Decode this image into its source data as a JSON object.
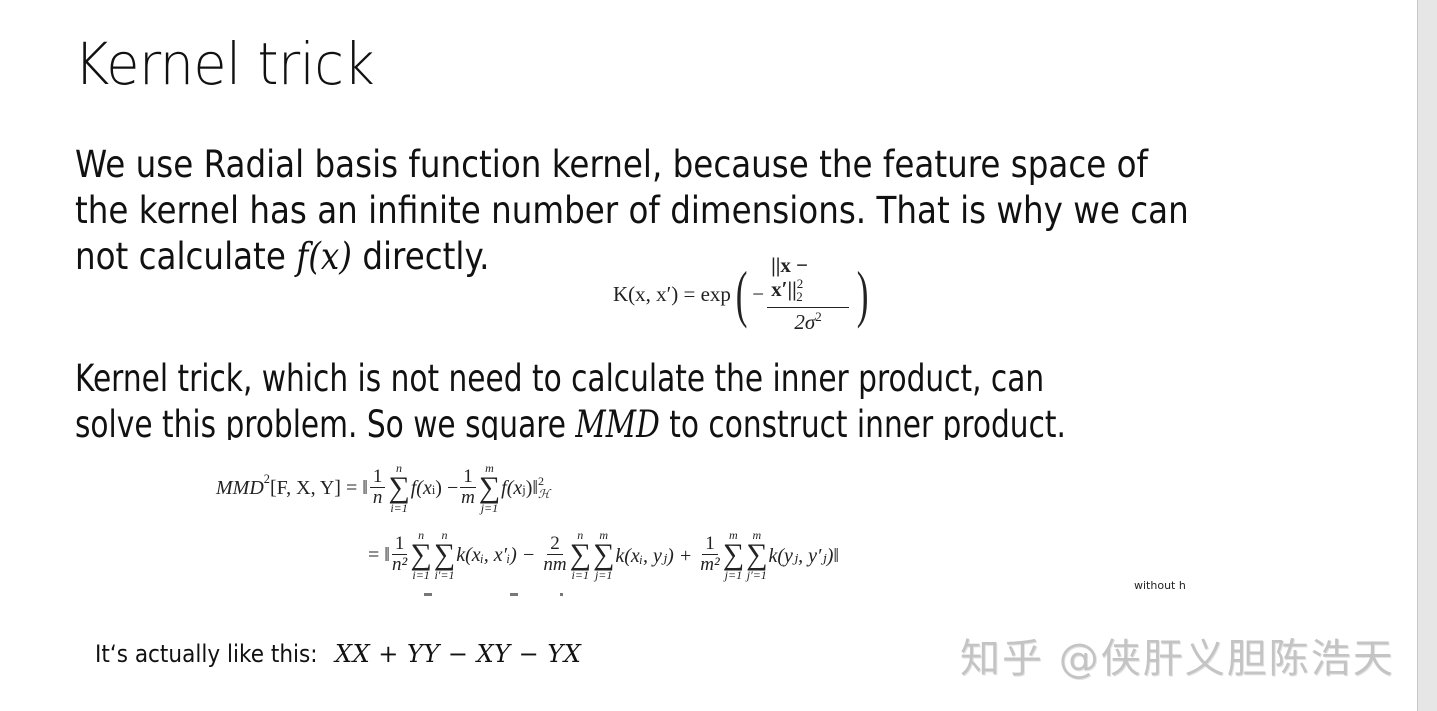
{
  "slide": {
    "title": "Kernel trick",
    "paragraph1": {
      "text_before": "We use Radial basis function kernel, because the feature space of the kernel has an infinite number of dimensions. That is why we can not calculate ",
      "line1": "We use Radial basis function kernel, because the feature space of",
      "line2": "the kernel has an infinite number of dimensions. That is why we can",
      "line3_before": "not calculate ",
      "math": "f(x)",
      "line3_after": " directly."
    },
    "rbf_formula": {
      "lhs": "K(x, x′) = exp",
      "numerator": "||x − x′||",
      "numerator_sup": "2",
      "numerator_sub": "2",
      "denominator": "2σ",
      "denominator_sup": "2",
      "sign": "−"
    },
    "paragraph2": {
      "line1": "Kernel trick, which is not need to calculate the inner product, can",
      "line2_before": "solve this problem. So we square ",
      "math": "MMD",
      "line2_after": " to construct inner product."
    },
    "mmd_formula": {
      "line1": {
        "lhs": "MMD",
        "lhs_sup": "2",
        "args": "[F, X, Y] = ‖",
        "frac1_num": "1",
        "frac1_den": "n",
        "sum1_top": "n",
        "sum1_bot": "i=1",
        "term1": "f(x",
        "term1_sub": "i",
        "minus": ") −",
        "frac2_num": "1",
        "frac2_den": "m",
        "sum2_top": "m",
        "sum2_bot": "j=1",
        "term2": "f(x",
        "term2_sub": "j",
        "end": ")‖",
        "end_sup": "2",
        "end_sub": "ℋ"
      },
      "line2": {
        "eq": "= ‖",
        "frac1_num": "1",
        "frac1_den": "n²",
        "sumA_top": "n",
        "sumA_bot": "i=1",
        "sumB_top": "n",
        "sumB_bot": "i′=1",
        "termA": "k(xᵢ, x′ᵢ) −",
        "frac2_num": "2",
        "frac2_den": "nm",
        "sumC_top": "n",
        "sumC_bot": "i=1",
        "sumD_top": "m",
        "sumD_bot": "j=1",
        "termB": "k(xᵢ, yⱼ) +",
        "frac3_num": "1",
        "frac3_den": "m²",
        "sumE_top": "m",
        "sumE_bot": "j=1",
        "sumF_top": "m",
        "sumF_bot": "j′=1",
        "termC": "k(yⱼ, y′ⱼ)‖"
      }
    },
    "small_note": "without h",
    "footer": {
      "label": "It‘s actually like this:",
      "expression": "XX + YY − XY − YX"
    },
    "watermark": "知乎 @侠肝义胆陈浩天"
  },
  "colors": {
    "background": "#ffffff",
    "text": "#111111",
    "watermark": "#c4c4c4",
    "side_panel": "#e6e6e6"
  }
}
